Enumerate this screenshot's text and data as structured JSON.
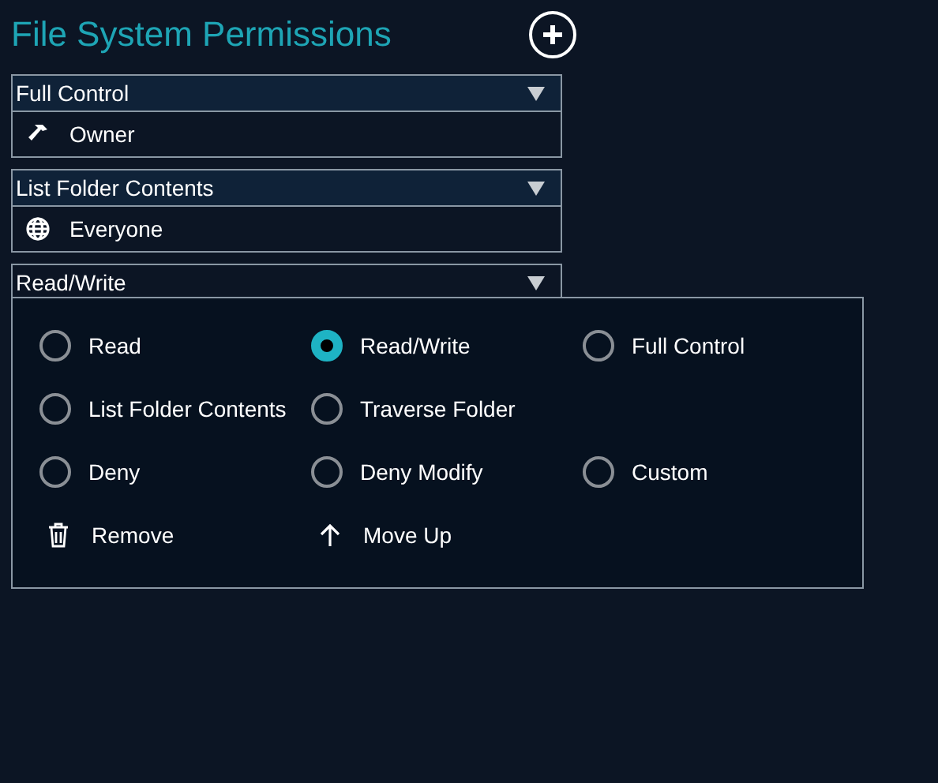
{
  "title": "File System Permissions",
  "entries": [
    {
      "permission": "Full Control",
      "principal": "Owner",
      "kind": "owner",
      "expanded": false
    },
    {
      "permission": "List Folder Contents",
      "principal": "Everyone",
      "kind": "everyone",
      "expanded": false
    },
    {
      "permission": "Read/Write",
      "expanded": true
    }
  ],
  "option_rows": [
    [
      {
        "label": "Read",
        "selected": false
      },
      {
        "label": "Read/Write",
        "selected": true
      },
      {
        "label": "Full Control",
        "selected": false
      }
    ],
    [
      {
        "label": "List Folder Contents",
        "selected": false
      },
      {
        "label": "Traverse Folder",
        "selected": false
      }
    ],
    [
      {
        "label": "Deny",
        "selected": false
      },
      {
        "label": "Deny Modify",
        "selected": false
      },
      {
        "label": "Custom",
        "selected": false
      }
    ]
  ],
  "actions": [
    {
      "label": "Remove",
      "kind": "remove"
    },
    {
      "label": "Move Up",
      "kind": "up"
    }
  ]
}
